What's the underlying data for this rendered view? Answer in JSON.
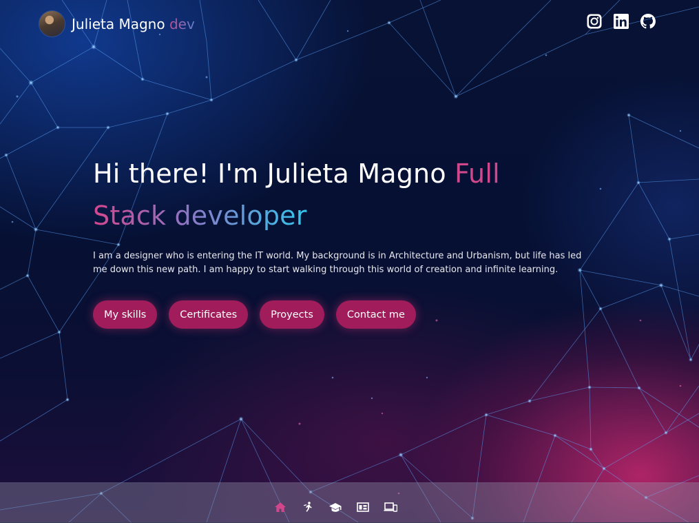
{
  "brand": {
    "name": "Julieta Magno",
    "suffix": "dev"
  },
  "social": {
    "icons": [
      "instagram-icon",
      "linkedin-icon",
      "github-icon"
    ]
  },
  "hero": {
    "greeting": "Hi there! I'm Julieta Magno ",
    "role_first": "Full",
    "role_rest": "Stack developer",
    "description": "I am a designer who is entering the IT world. My background is in Architecture and Urbanism, but life has led me down this new path. I am happy to start walking through this world of creation and infinite learning."
  },
  "buttons": {
    "skills": "My skills",
    "certificates": "Certificates",
    "projects": "Proyects",
    "contact": "Contact me"
  },
  "bottom_nav": {
    "icons": [
      "home-icon",
      "skills-icon",
      "graduation-cap-icon",
      "projects-icon",
      "devices-icon"
    ],
    "active": "home-icon"
  },
  "colors": {
    "accent": "#d1478b",
    "button": "#a11c5a",
    "cyan": "#33c6ec",
    "text": "#ffffff"
  }
}
